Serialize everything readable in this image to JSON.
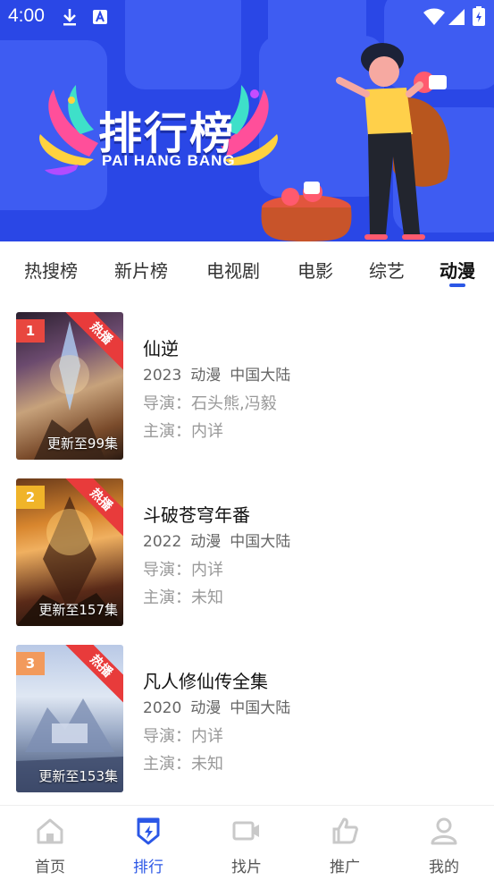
{
  "status_bar": {
    "time": "4:00"
  },
  "banner": {
    "title": "排行榜",
    "subtitle": "PAI HANG BANG"
  },
  "tabs": [
    {
      "label": "热搜榜",
      "active": false
    },
    {
      "label": "新片榜",
      "active": false
    },
    {
      "label": "电视剧",
      "active": false
    },
    {
      "label": "电影",
      "active": false
    },
    {
      "label": "综艺",
      "active": false
    },
    {
      "label": "动漫",
      "active": true
    }
  ],
  "list": [
    {
      "rank": "1",
      "hot_label": "热播",
      "update": "更新至99集",
      "title": "仙逆",
      "year": "2023",
      "genre": "动漫",
      "region": "中国大陆",
      "director": "导演：石头熊,冯毅",
      "actor": "主演：内详",
      "rank_color": "#e8473f"
    },
    {
      "rank": "2",
      "hot_label": "热播",
      "update": "更新至157集",
      "title": "斗破苍穹年番",
      "year": "2022",
      "genre": "动漫",
      "region": "中国大陆",
      "director": "导演：内详",
      "actor": "主演：未知",
      "rank_color": "#f0b429"
    },
    {
      "rank": "3",
      "hot_label": "热播",
      "update": "更新至153集",
      "title": "凡人修仙传全集",
      "year": "2020",
      "genre": "动漫",
      "region": "中国大陆",
      "director": "导演：内详",
      "actor": "主演：未知",
      "rank_color": "#f29a5c"
    }
  ],
  "bottom_nav": [
    {
      "label": "首页",
      "icon": "home-icon",
      "active": false
    },
    {
      "label": "排行",
      "icon": "ranking-icon",
      "active": true
    },
    {
      "label": "找片",
      "icon": "video-camera-icon",
      "active": false
    },
    {
      "label": "推广",
      "icon": "thumbs-up-icon",
      "active": false
    },
    {
      "label": "我的",
      "icon": "user-icon",
      "active": false
    }
  ],
  "colors": {
    "accent": "#2b57e6",
    "banner_bg": "#2a47e6",
    "hot_ribbon": "#e83b3b"
  }
}
